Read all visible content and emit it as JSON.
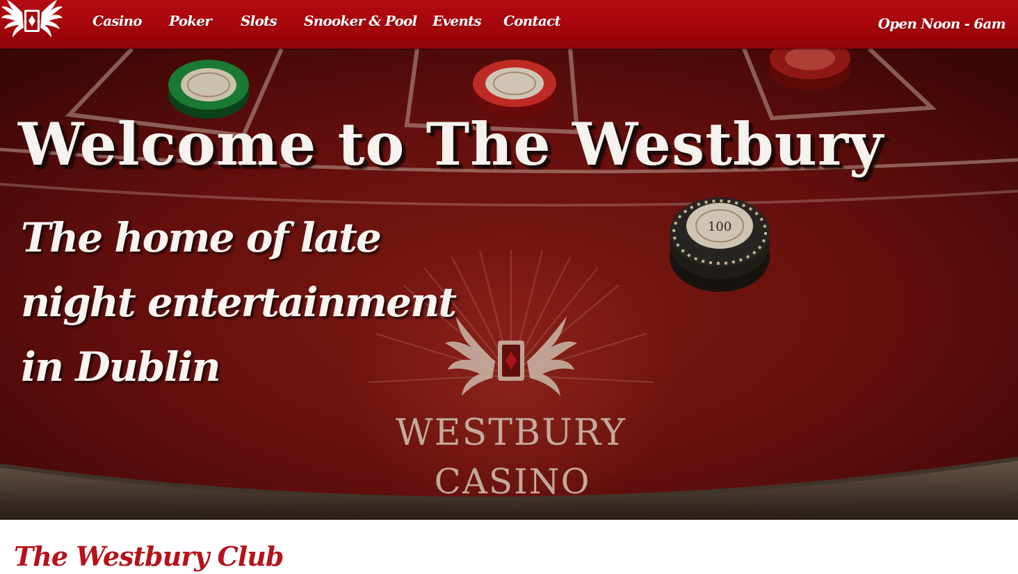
{
  "nav": {
    "items": [
      {
        "label": "Casino"
      },
      {
        "label": "Poker"
      },
      {
        "label": "Slots"
      },
      {
        "label": "Snooker & Pool"
      },
      {
        "label": "Events"
      },
      {
        "label": "Contact"
      }
    ],
    "hours": "Open Noon - 6am",
    "logo_icon": "winged-card-logo-icon"
  },
  "hero": {
    "title": "Welcome to The Westbury",
    "subtitle": "The home of late night entertainment in Dublin",
    "table_logo_line1": "WESTBURY",
    "table_logo_line2": "CASINO",
    "chip_label": "100"
  },
  "club": {
    "title": "The Westbury Club"
  },
  "colors": {
    "nav_red": "#a5060c",
    "felt_red": "#7a1411",
    "club_title_red": "#b5121b"
  }
}
